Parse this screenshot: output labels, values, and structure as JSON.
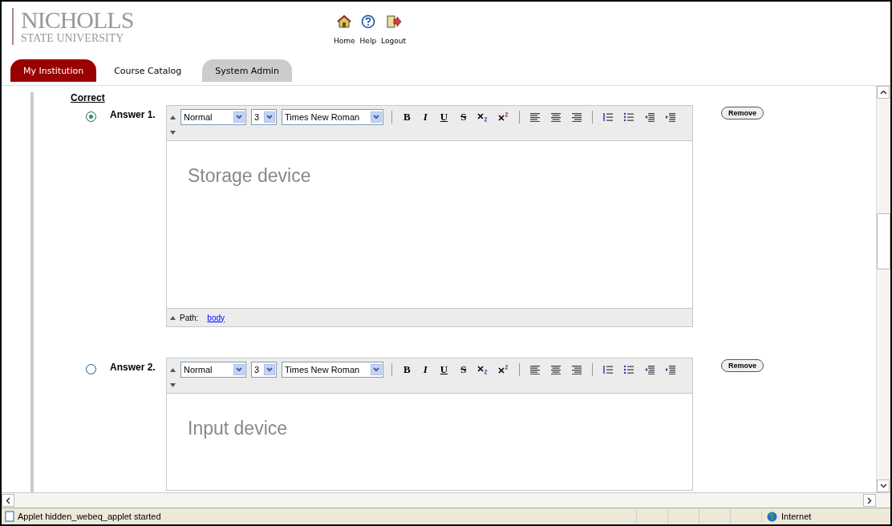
{
  "header": {
    "logo": {
      "line1": "NICHOLLS",
      "line2": "STATE UNIVERSITY"
    },
    "nav": [
      {
        "kind": "home",
        "label": "Home"
      },
      {
        "kind": "help",
        "label": "Help"
      },
      {
        "kind": "logout",
        "label": "Logout"
      }
    ],
    "tabs": [
      {
        "label": "My Institution",
        "selected": true,
        "kind": "filled"
      },
      {
        "label": "Course Catalog",
        "selected": false,
        "kind": "plain"
      },
      {
        "label": "System Admin",
        "selected": false,
        "kind": "filled"
      }
    ]
  },
  "section_heading": "Correct",
  "answers": [
    {
      "label": "Answer 1.",
      "selected": true,
      "format": "Normal",
      "size": "3",
      "font": "Times New Roman",
      "styles": [
        "B",
        "I",
        "U",
        "S"
      ],
      "content": "Storage device",
      "path_label": "Path:",
      "path_link": "body",
      "button": "Remove"
    },
    {
      "label": "Answer 2.",
      "selected": false,
      "format": "Normal",
      "size": "3",
      "font": "Times New Roman",
      "styles": [
        "B",
        "I",
        "U",
        "S"
      ],
      "content": "Input device",
      "button": "Remove"
    }
  ],
  "status_bar": {
    "message": "Applet hidden_webeq_applet started",
    "zone": "Internet"
  }
}
